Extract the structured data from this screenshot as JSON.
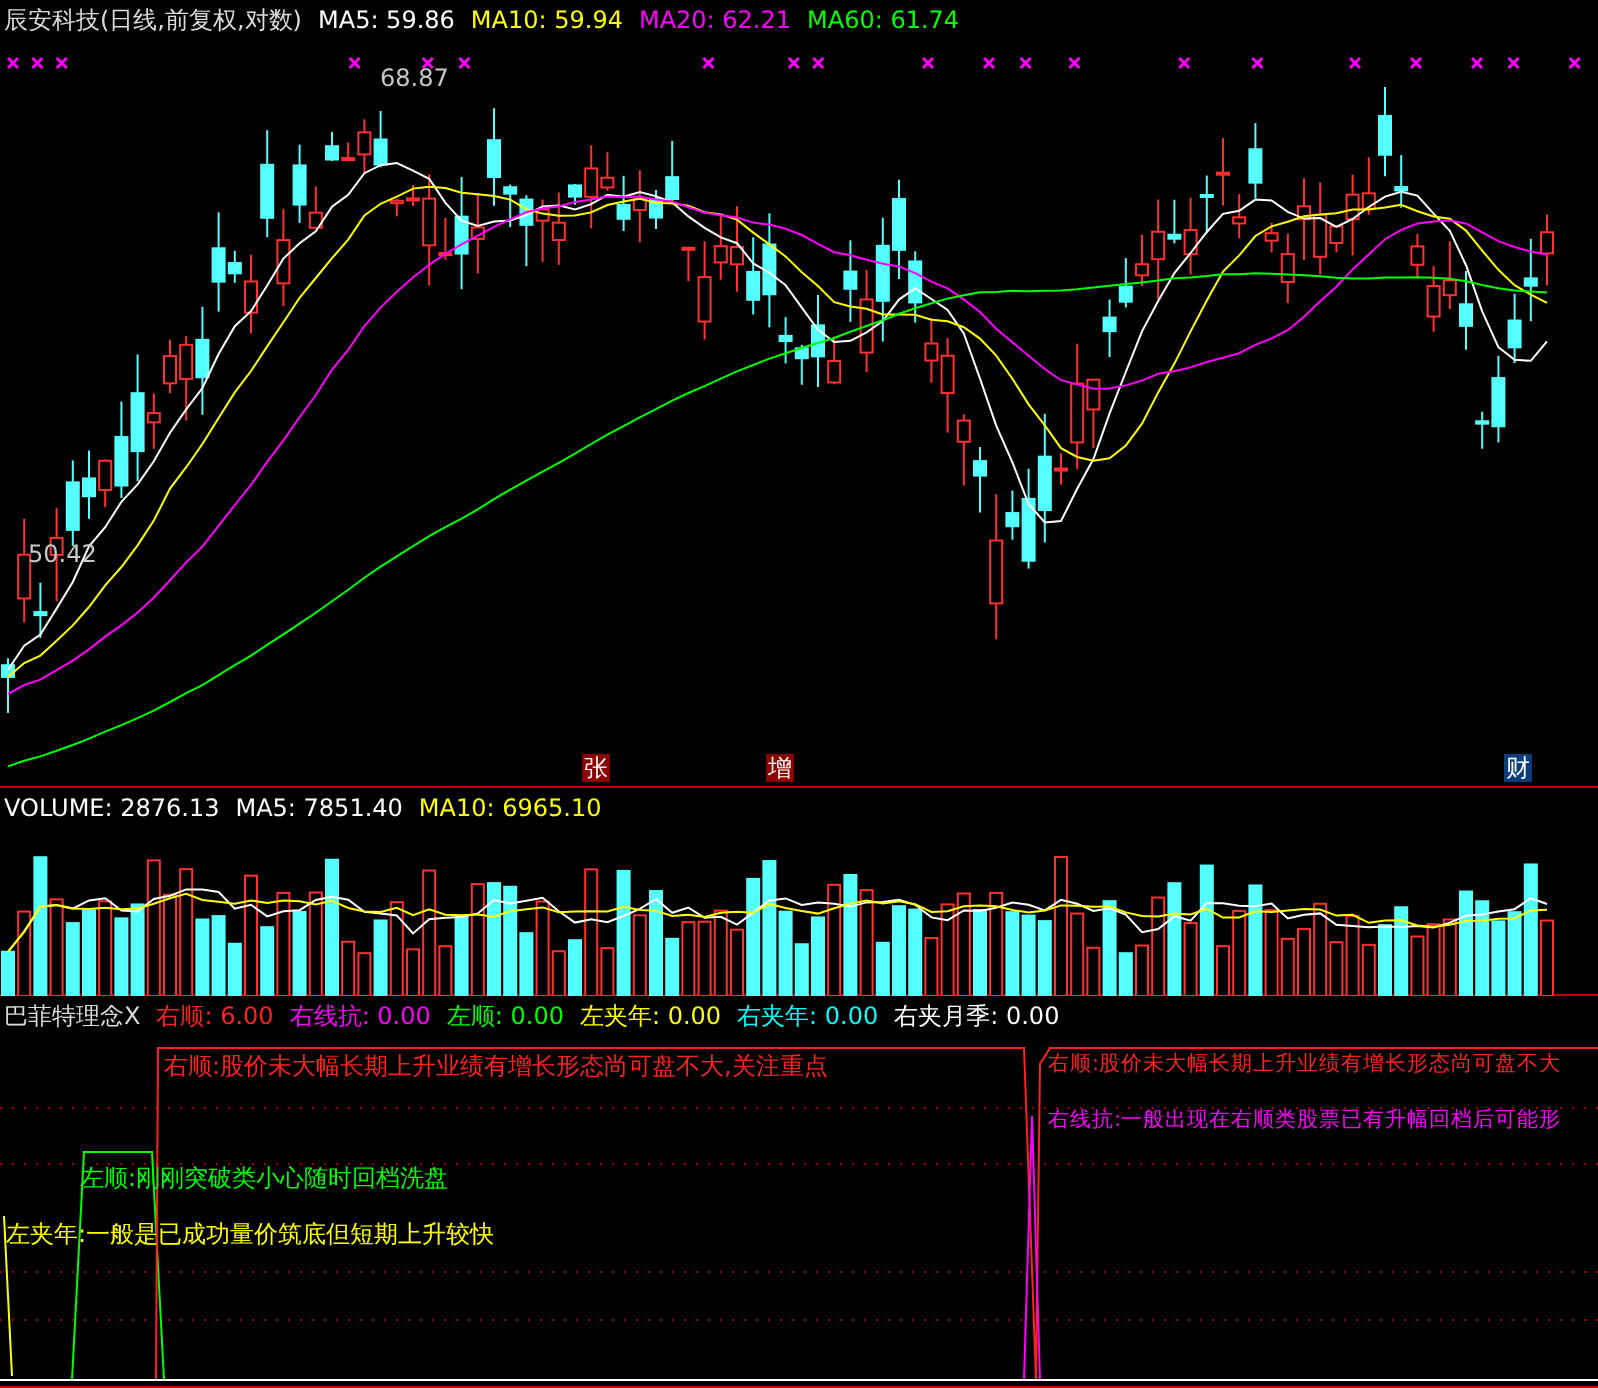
{
  "stock_header": {
    "title": "辰安科技(日线,前复权,对数)",
    "averages": [
      {
        "label": "MA5: 59.86",
        "color": "#ffffff"
      },
      {
        "label": "MA10: 59.94",
        "color": "#ffff00"
      },
      {
        "label": "MA20: 62.21",
        "color": "#ff00ff"
      },
      {
        "label": "MA60: 61.74",
        "color": "#00ff00"
      }
    ]
  },
  "price_chart": {
    "high_label": "68.87",
    "low_label": "50.42",
    "event_markers": [
      {
        "text": "张",
        "color": "#8b0000"
      },
      {
        "text": "增",
        "color": "#8b0000"
      },
      {
        "text": "财",
        "color": "#0c3c7c"
      }
    ]
  },
  "volume_header": {
    "items": [
      {
        "label": "VOLUME: 2876.13",
        "color": "#ffffff"
      },
      {
        "label": "MA5: 7851.40",
        "color": "#ffffff"
      },
      {
        "label": "MA10: 6965.10",
        "color": "#ffff00"
      }
    ]
  },
  "indicator_header": {
    "title": "巴菲特理念X",
    "items": [
      {
        "label": "右顺: 6.00",
        "color": "#ff2020"
      },
      {
        "label": "右线抗: 0.00",
        "color": "#ff00ff"
      },
      {
        "label": "左顺: 0.00",
        "color": "#00ff00"
      },
      {
        "label": "左夹年: 0.00",
        "color": "#ffff00"
      },
      {
        "label": "右夹年: 0.00",
        "color": "#00ffff"
      },
      {
        "label": "右夹月季: 0.00",
        "color": "#ffffff"
      }
    ]
  },
  "indicator_notes": [
    {
      "text": "右顺:股价未大幅长期上升业绩有增长形态尚可盘不大,关注重点",
      "color": "#ff2020"
    },
    {
      "text": "右顺:股价未大幅长期上升业绩有增长形态尚可盘不大",
      "color": "#ff2020"
    },
    {
      "text": "右线抗:一般出现在右顺类股票已有升幅回档后可能形",
      "color": "#ff00ff"
    },
    {
      "text": "左顺:刚刚突破类小心随时回档洗盘",
      "color": "#00ff00"
    },
    {
      "text": "左夹年:一般是已成功量价筑底但短期上升较快",
      "color": "#ffff00"
    }
  ]
}
